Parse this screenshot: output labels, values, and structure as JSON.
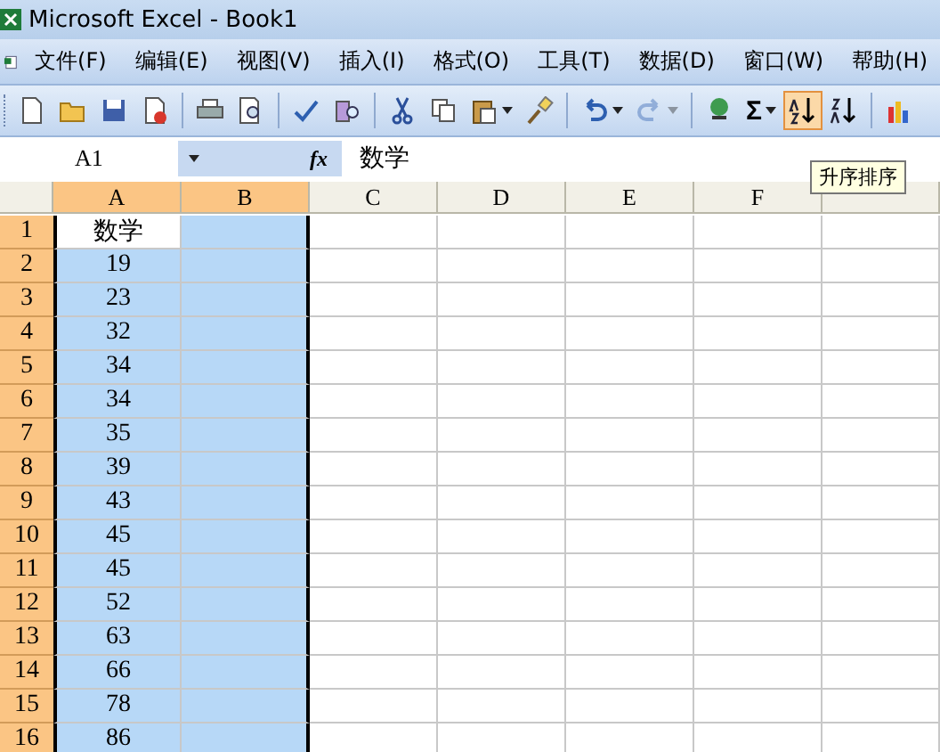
{
  "window": {
    "title": "Microsoft Excel - Book1"
  },
  "menu": [
    "文件(F)",
    "编辑(E)",
    "视图(V)",
    "插入(I)",
    "格式(O)",
    "工具(T)",
    "数据(D)",
    "窗口(W)",
    "帮助(H)"
  ],
  "toolbar": [
    {
      "kind": "new",
      "pressed": false,
      "disabled": false
    },
    {
      "kind": "open",
      "pressed": false,
      "disabled": false
    },
    {
      "kind": "save",
      "pressed": false,
      "disabled": false
    },
    {
      "kind": "permission",
      "pressed": false,
      "disabled": false
    },
    {
      "kind": "separator"
    },
    {
      "kind": "print",
      "pressed": false,
      "disabled": false
    },
    {
      "kind": "preview",
      "pressed": false,
      "disabled": false
    },
    {
      "kind": "separator"
    },
    {
      "kind": "spelling",
      "pressed": false,
      "disabled": false
    },
    {
      "kind": "research",
      "pressed": false,
      "disabled": false
    },
    {
      "kind": "separator"
    },
    {
      "kind": "cut",
      "pressed": false,
      "disabled": false
    },
    {
      "kind": "copy",
      "pressed": false,
      "disabled": false
    },
    {
      "kind": "paste",
      "pressed": false,
      "disabled": false
    },
    {
      "kind": "painter",
      "pressed": false,
      "disabled": false
    },
    {
      "kind": "separator"
    },
    {
      "kind": "undo",
      "pressed": false,
      "disabled": false
    },
    {
      "kind": "redo",
      "pressed": false,
      "disabled": true
    },
    {
      "kind": "separator"
    },
    {
      "kind": "hyperlink",
      "pressed": false,
      "disabled": false
    },
    {
      "kind": "sum",
      "label": "Σ",
      "pressed": false,
      "disabled": false
    },
    {
      "kind": "sort-asc",
      "pressed": true,
      "disabled": false
    },
    {
      "kind": "sort-desc",
      "pressed": false,
      "disabled": false
    },
    {
      "kind": "separator"
    },
    {
      "kind": "chart",
      "pressed": false,
      "disabled": false
    }
  ],
  "formula_bar": {
    "name_box": "A1",
    "fx": "fx",
    "value": "数学"
  },
  "tooltip": "升序排序",
  "columns": [
    {
      "label": "A",
      "selected": true
    },
    {
      "label": "B",
      "selected": true
    },
    {
      "label": "C",
      "selected": false
    },
    {
      "label": "D",
      "selected": false
    },
    {
      "label": "E",
      "selected": false
    },
    {
      "label": "F",
      "selected": false
    },
    {
      "selected": false
    }
  ],
  "rows": [
    {
      "header": "1",
      "selected": true,
      "cells": [
        {
          "text": "数学",
          "active": true
        }
      ]
    },
    {
      "header": "2",
      "selected": true,
      "cells": [
        {
          "text": "19",
          "active": false
        }
      ]
    },
    {
      "header": "3",
      "selected": true,
      "cells": [
        {
          "text": "23",
          "active": false
        }
      ]
    },
    {
      "header": "4",
      "selected": true,
      "cells": [
        {
          "text": "32",
          "active": false
        }
      ]
    },
    {
      "header": "5",
      "selected": true,
      "cells": [
        {
          "text": "34",
          "active": false
        }
      ]
    },
    {
      "header": "6",
      "selected": true,
      "cells": [
        {
          "text": "34",
          "active": false
        }
      ]
    },
    {
      "header": "7",
      "selected": true,
      "cells": [
        {
          "text": "35",
          "active": false
        }
      ]
    },
    {
      "header": "8",
      "selected": true,
      "cells": [
        {
          "text": "39",
          "active": false
        }
      ]
    },
    {
      "header": "9",
      "selected": true,
      "cells": [
        {
          "text": "43",
          "active": false
        }
      ]
    },
    {
      "header": "10",
      "selected": true,
      "cells": [
        {
          "text": "45",
          "active": false
        }
      ]
    },
    {
      "header": "11",
      "selected": true,
      "cells": [
        {
          "text": "45",
          "active": false
        }
      ]
    },
    {
      "header": "12",
      "selected": true,
      "cells": [
        {
          "text": "52",
          "active": false
        }
      ]
    },
    {
      "header": "13",
      "selected": true,
      "cells": [
        {
          "text": "63",
          "active": false
        }
      ]
    },
    {
      "header": "14",
      "selected": true,
      "cells": [
        {
          "text": "66",
          "active": false
        }
      ]
    },
    {
      "header": "15",
      "selected": true,
      "cells": [
        {
          "text": "78",
          "active": false
        }
      ]
    },
    {
      "header": "16",
      "selected": true,
      "cells": [
        {
          "text": "86",
          "active": false
        }
      ]
    }
  ]
}
